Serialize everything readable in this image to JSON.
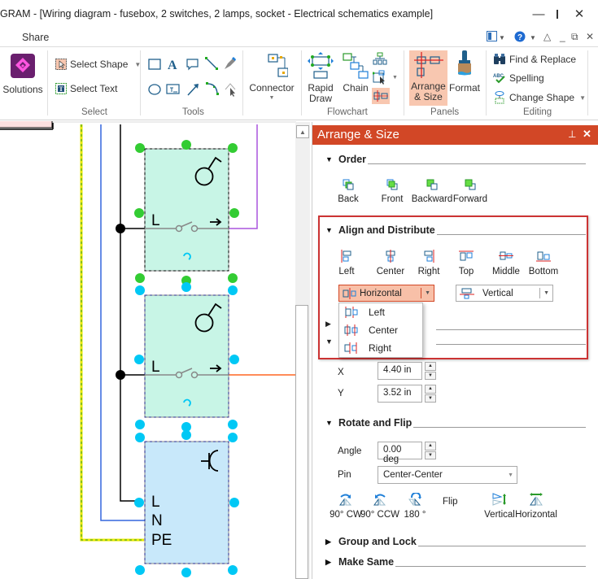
{
  "window": {
    "title": "GRAM - [Wiring diagram - fusebox, 2 switches, 2 lamps, socket - Electrical schematics example]",
    "minimize_icon": "minimize-icon",
    "maximize_icon": "maximize-icon",
    "close_icon": "close-icon"
  },
  "menu": {
    "share_label": "Share",
    "right_icons": [
      "layout-icon",
      "help-icon",
      "collapse-ribbon-icon",
      "restore-icon",
      "close-doc-icon"
    ]
  },
  "ribbon": {
    "solutions_label": "Solutions",
    "select_group": {
      "label": "Select",
      "select_shape": "Select Shape",
      "select_text": "Select Text"
    },
    "tools_group": {
      "label": "Tools"
    },
    "connector_label": "Connector",
    "flowchart_group": {
      "label": "Flowchart",
      "rapid_draw_1": "Rapid",
      "rapid_draw_2": "Draw",
      "chain": "Chain"
    },
    "panels_group": {
      "label": "Panels",
      "arrange_1": "Arrange",
      "arrange_2": "& Size",
      "format": "Format"
    },
    "editing_group": {
      "label": "Editing",
      "find_replace": "Find & Replace",
      "spelling": "Spelling",
      "change_shape": "Change Shape"
    }
  },
  "canvas": {
    "switch1": {
      "label": "L"
    },
    "switch2": {
      "label": "L"
    },
    "socket": {
      "label_l": "L",
      "label_n": "N",
      "label_pe": "PE"
    },
    "colors": {
      "switch_fill": "#c8f5e6",
      "socket_fill": "#c8e8fa",
      "handle_green": "#33cc33",
      "handle_cyan": "#00c8f5",
      "wire_neutral": "#3366dd",
      "wire_pe": "#e8e800",
      "wire_purple": "#aa55dd",
      "wire_orange": "#ff6622"
    }
  },
  "panel": {
    "title": "Arrange & Size",
    "accent": "#d24726",
    "order": {
      "heading": "Order",
      "buttons": [
        "Back",
        "Front",
        "Backward",
        "Forward"
      ]
    },
    "align": {
      "heading": "Align and Distribute",
      "buttons": [
        "Left",
        "Center",
        "Right",
        "Top",
        "Middle",
        "Bottom"
      ],
      "horizontal_select": "Horizontal",
      "vertical_select": "Vertical",
      "dropdown_options": [
        "Left",
        "Center",
        "Right"
      ]
    },
    "position": {
      "x_label": "X",
      "x_value": "4.40 in",
      "y_label": "Y",
      "y_value": "3.52 in"
    },
    "rotate": {
      "heading": "Rotate and Flip",
      "angle_label": "Angle",
      "angle_value": "0.00 deg",
      "pin_label": "Pin",
      "pin_value": "Center-Center",
      "buttons": [
        "90° CW",
        "90° CCW",
        "180 °"
      ],
      "flip_label": "Flip",
      "flip_buttons": [
        "Vertical",
        "Horizontal"
      ]
    },
    "group_lock": {
      "heading": "Group and Lock"
    },
    "make_same": {
      "heading": "Make Same"
    }
  }
}
